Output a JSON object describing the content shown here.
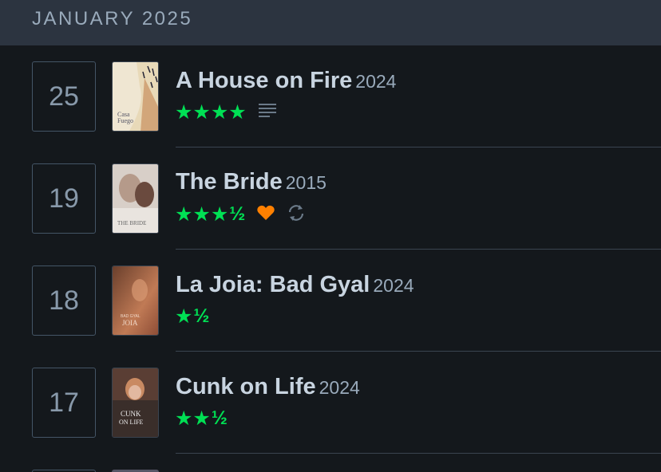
{
  "month": {
    "title": "JANUARY 2025"
  },
  "entries": [
    {
      "day": "25",
      "title": "A House on Fire",
      "year": "2024",
      "stars": "★★★★",
      "half": "",
      "liked": false,
      "icons": [
        "review-text-icon"
      ]
    },
    {
      "day": "19",
      "title": "The Bride",
      "year": "2015",
      "stars": "★★★",
      "half": "½",
      "liked": true,
      "icons": [
        "heart-icon",
        "rewatch-icon"
      ]
    },
    {
      "day": "18",
      "title": "La Joia: Bad Gyal",
      "year": "2024",
      "stars": "★",
      "half": "½",
      "liked": false,
      "icons": []
    },
    {
      "day": "17",
      "title": "Cunk on Life",
      "year": "2024",
      "stars": "★★",
      "half": "½",
      "liked": false,
      "icons": []
    }
  ],
  "colors": {
    "star": "#00e054",
    "heart": "#ff8000",
    "header_bg": "#2c3440",
    "page_bg": "#14181c"
  }
}
